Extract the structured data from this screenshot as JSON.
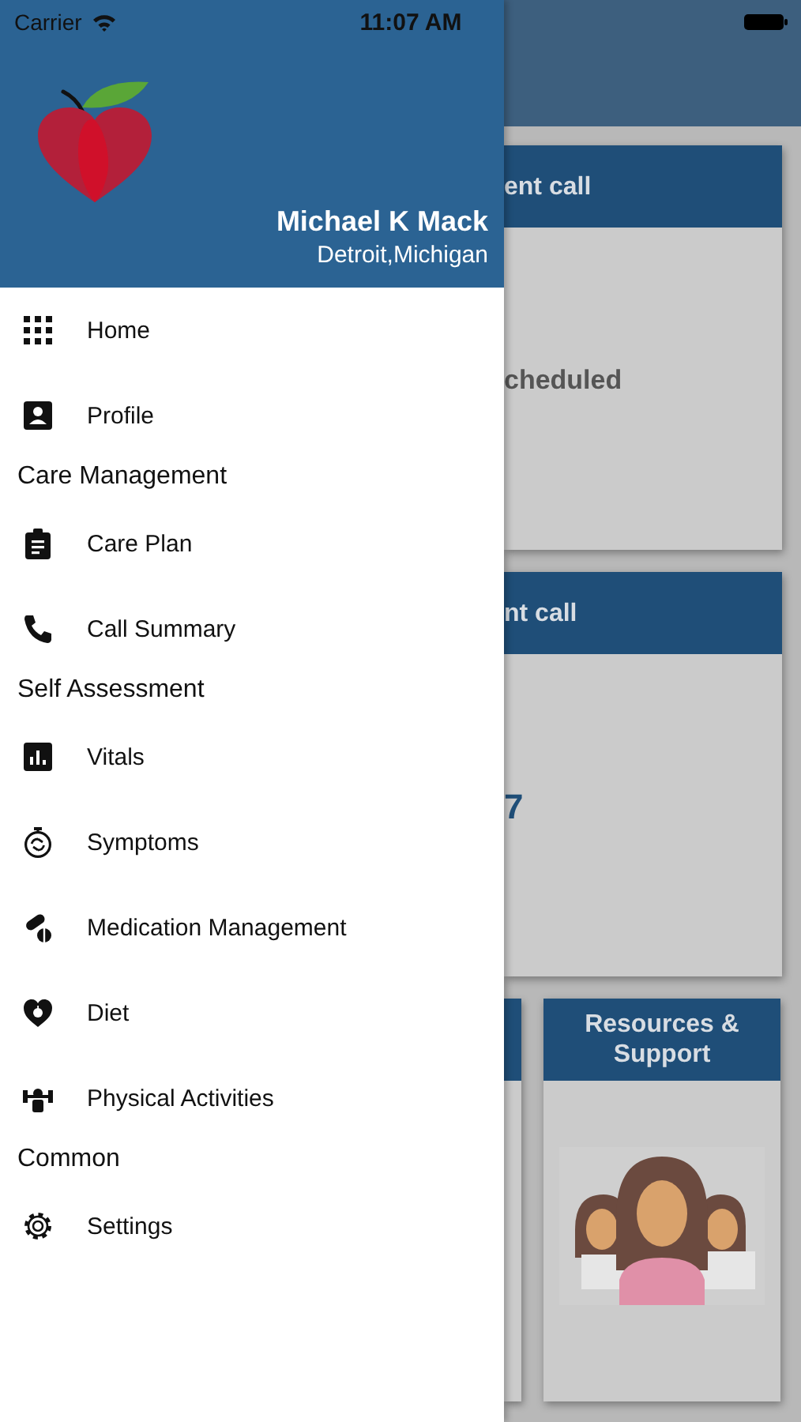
{
  "status_bar": {
    "carrier": "Carrier",
    "time": "11:07 AM"
  },
  "drawer": {
    "header": {
      "name": "Michael K Mack",
      "location": "Detroit,Michigan"
    },
    "menu": [
      {
        "kind": "item",
        "label": "Home"
      },
      {
        "kind": "item",
        "label": "Profile"
      },
      {
        "kind": "section",
        "label": "Care Management"
      },
      {
        "kind": "item",
        "label": "Care Plan"
      },
      {
        "kind": "item",
        "label": "Call Summary"
      },
      {
        "kind": "section",
        "label": "Self Assessment"
      },
      {
        "kind": "item",
        "label": "Vitals"
      },
      {
        "kind": "item",
        "label": "Symptoms"
      },
      {
        "kind": "item",
        "label": "Medication Management"
      },
      {
        "kind": "item",
        "label": "Diet"
      },
      {
        "kind": "item",
        "label": "Physical Activities"
      },
      {
        "kind": "section",
        "label": "Common"
      },
      {
        "kind": "item",
        "label": "Settings"
      }
    ]
  },
  "background_screen": {
    "cards": [
      {
        "kind": "text",
        "title": "ent call",
        "body": "cheduled"
      },
      {
        "kind": "number",
        "title": "nt call",
        "body": "7"
      },
      {
        "kind": "blank"
      },
      {
        "kind": "picture",
        "title": "Resources & Support"
      }
    ]
  }
}
